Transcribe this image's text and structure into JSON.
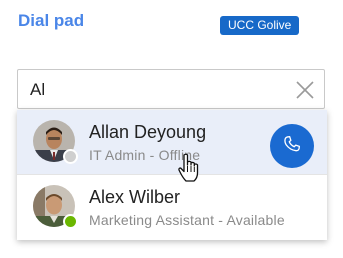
{
  "header": {
    "title": "Dial pad",
    "badge": "UCC Golive",
    "badge_color": "#1769c8",
    "title_color": "#4a86e8"
  },
  "search": {
    "value": "Al",
    "clear_icon": "close-icon"
  },
  "results": [
    {
      "name": "Allan Deyoung",
      "subtitle": "IT Admin - Offline",
      "presence": "offline",
      "presence_color": "#cfcfcf",
      "highlighted": true,
      "call_icon": "phone-icon"
    },
    {
      "name": "Alex Wilber",
      "subtitle": "Marketing Assistant - Available",
      "presence": "available",
      "presence_color": "#6bb700",
      "highlighted": false
    }
  ],
  "colors": {
    "call_button": "#1a6ad1",
    "highlight_row": "#e9eef9"
  }
}
